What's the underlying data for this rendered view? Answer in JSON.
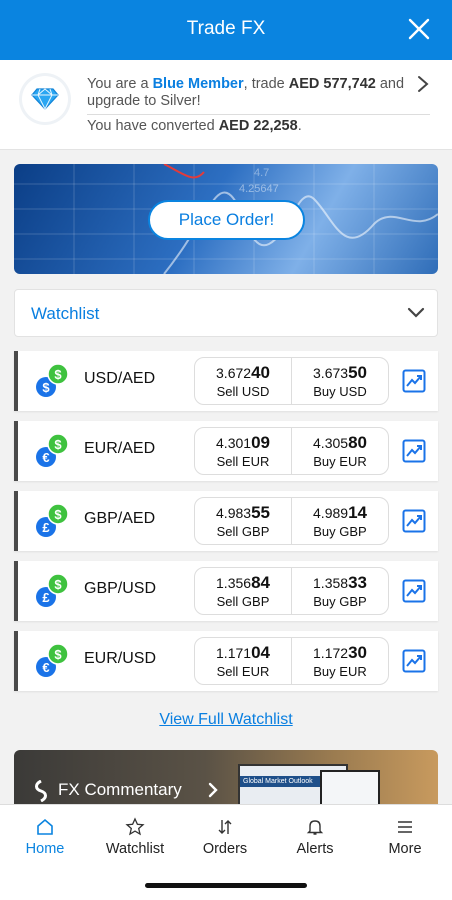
{
  "header": {
    "title": "Trade FX"
  },
  "member": {
    "prefix": "You are a ",
    "tier": "Blue Member",
    "mid": ", trade ",
    "amount": "AED 577,742",
    "suffix": " and upgrade to Silver!",
    "converted_prefix": "You have converted ",
    "converted_amount": "AED 22,258",
    "converted_suffix": "."
  },
  "banner": {
    "button_label": "Place Order!"
  },
  "watchlist": {
    "title": "Watchlist",
    "rows": [
      {
        "pair": "USD/AED",
        "currency_icon": "dollar",
        "sell_main": "3.672",
        "sell_big": "40",
        "sell_label": "Sell USD",
        "buy_main": "3.673",
        "buy_big": "50",
        "buy_label": "Buy USD"
      },
      {
        "pair": "EUR/AED",
        "currency_icon": "euro",
        "sell_main": "4.301",
        "sell_big": "09",
        "sell_label": "Sell EUR",
        "buy_main": "4.305",
        "buy_big": "80",
        "buy_label": "Buy EUR"
      },
      {
        "pair": "GBP/AED",
        "currency_icon": "pound",
        "sell_main": "4.983",
        "sell_big": "55",
        "sell_label": "Sell GBP",
        "buy_main": "4.989",
        "buy_big": "14",
        "buy_label": "Buy GBP"
      },
      {
        "pair": "GBP/USD",
        "currency_icon": "pound",
        "sell_main": "1.356",
        "sell_big": "84",
        "sell_label": "Sell GBP",
        "buy_main": "1.358",
        "buy_big": "33",
        "buy_label": "Buy GBP"
      },
      {
        "pair": "EUR/USD",
        "currency_icon": "euro",
        "sell_main": "1.171",
        "sell_big": "04",
        "sell_label": "Sell EUR",
        "buy_main": "1.172",
        "buy_big": "30",
        "buy_label": "Buy EUR"
      }
    ],
    "view_full": "View Full Watchlist"
  },
  "commentary": {
    "title": "FX Commentary",
    "doc_title": "Global Market Outlook"
  },
  "tabs": [
    {
      "label": "Home",
      "icon": "home-icon",
      "active": true
    },
    {
      "label": "Watchlist",
      "icon": "star-icon",
      "active": false
    },
    {
      "label": "Orders",
      "icon": "swap-arrows-icon",
      "active": false
    },
    {
      "label": "Alerts",
      "icon": "bell-icon",
      "active": false
    },
    {
      "label": "More",
      "icon": "menu-icon",
      "active": false
    }
  ],
  "colors": {
    "primary": "#0a84e0",
    "green": "#3fc23f",
    "blue_icon": "#1a73e8"
  }
}
